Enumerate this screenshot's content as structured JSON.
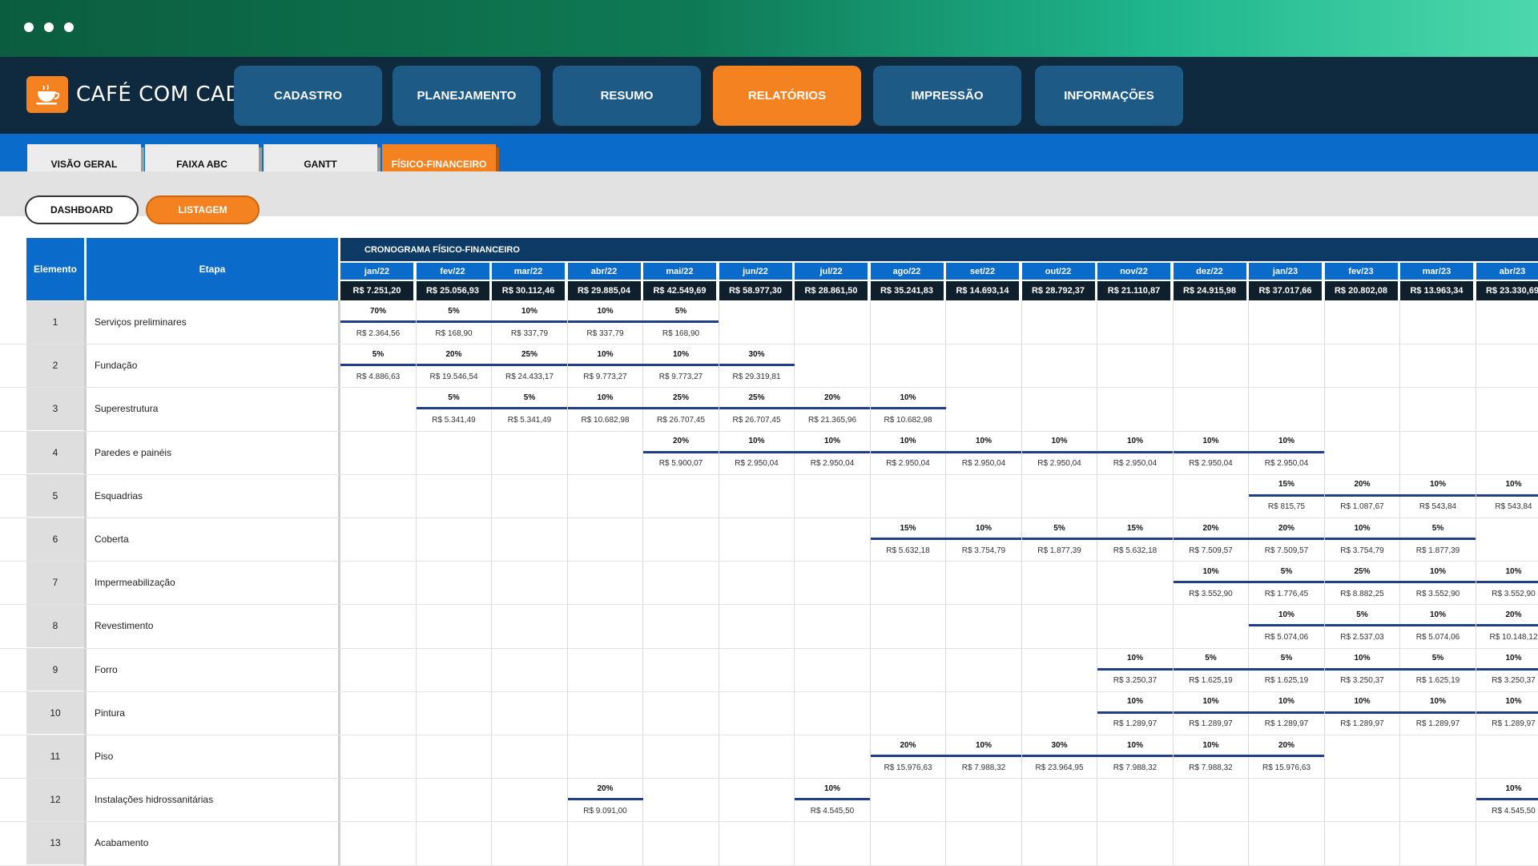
{
  "app": {
    "logo_text": "CAFÉ COM CAD"
  },
  "nav": [
    {
      "label": "CADASTRO",
      "active": false
    },
    {
      "label": "PLANEJAMENTO",
      "active": false
    },
    {
      "label": "RESUMO",
      "active": false
    },
    {
      "label": "RELATÓRIOS",
      "active": true
    },
    {
      "label": "IMPRESSÃO",
      "active": false
    },
    {
      "label": "INFORMAÇÕES",
      "active": false
    }
  ],
  "subtabs": [
    {
      "label": "VISÃO GERAL",
      "active": false
    },
    {
      "label": "FAIXA ABC",
      "active": false
    },
    {
      "label": "GANTT",
      "active": false
    },
    {
      "label": "FÍSICO-FINANCEIRO",
      "active": true
    }
  ],
  "views": [
    {
      "label": "DASHBOARD",
      "active": false
    },
    {
      "label": "LISTAGEM",
      "active": true
    }
  ],
  "colors": {
    "accent": "#f58220",
    "navy": "#0f2a3e",
    "blue": "#0b6bcb",
    "bar": "#1f3f8a"
  },
  "table": {
    "col_elemento": "Elemento",
    "col_etapa": "Etapa",
    "schedule_title": "CRONOGRAMA FÍSICO-FINANCEIRO",
    "months": [
      {
        "label": "jan/22",
        "total": "R$ 7.251,20"
      },
      {
        "label": "fev/22",
        "total": "R$ 25.056,93"
      },
      {
        "label": "mar/22",
        "total": "R$ 30.112,46"
      },
      {
        "label": "abr/22",
        "total": "R$ 29.885,04"
      },
      {
        "label": "mai/22",
        "total": "R$ 42.549,69"
      },
      {
        "label": "jun/22",
        "total": "R$ 58.977,30"
      },
      {
        "label": "jul/22",
        "total": "R$ 28.861,50"
      },
      {
        "label": "ago/22",
        "total": "R$ 35.241,83"
      },
      {
        "label": "set/22",
        "total": "R$ 14.693,14"
      },
      {
        "label": "out/22",
        "total": "R$ 28.792,37"
      },
      {
        "label": "nov/22",
        "total": "R$ 21.110,87"
      },
      {
        "label": "dez/22",
        "total": "R$ 24.915,98"
      },
      {
        "label": "jan/23",
        "total": "R$ 37.017,66"
      },
      {
        "label": "fev/23",
        "total": "R$ 20.802,08"
      },
      {
        "label": "mar/23",
        "total": "R$ 13.963,34"
      },
      {
        "label": "abr/23",
        "total": "R$ 23.330,69"
      }
    ],
    "rows": [
      {
        "id": "1",
        "name": "Serviços preliminares",
        "cells": [
          [
            0,
            "70%",
            "R$ 2.364,56"
          ],
          [
            1,
            "5%",
            "R$ 168,90"
          ],
          [
            2,
            "10%",
            "R$ 337,79"
          ],
          [
            3,
            "10%",
            "R$ 337,79"
          ],
          [
            4,
            "5%",
            "R$ 168,90"
          ]
        ]
      },
      {
        "id": "2",
        "name": "Fundação",
        "cells": [
          [
            0,
            "5%",
            "R$ 4.886,63"
          ],
          [
            1,
            "20%",
            "R$ 19.546,54"
          ],
          [
            2,
            "25%",
            "R$ 24.433,17"
          ],
          [
            3,
            "10%",
            "R$ 9.773,27"
          ],
          [
            4,
            "10%",
            "R$ 9.773,27"
          ],
          [
            5,
            "30%",
            "R$ 29.319,81"
          ]
        ]
      },
      {
        "id": "3",
        "name": "Superestrutura",
        "cells": [
          [
            1,
            "5%",
            "R$ 5.341,49"
          ],
          [
            2,
            "5%",
            "R$ 5.341,49"
          ],
          [
            3,
            "10%",
            "R$ 10.682,98"
          ],
          [
            4,
            "25%",
            "R$ 26.707,45"
          ],
          [
            5,
            "25%",
            "R$ 26.707,45"
          ],
          [
            6,
            "20%",
            "R$ 21.365,96"
          ],
          [
            7,
            "10%",
            "R$ 10.682,98"
          ]
        ]
      },
      {
        "id": "4",
        "name": "Paredes e painéis",
        "cells": [
          [
            4,
            "20%",
            "R$ 5.900,07"
          ],
          [
            5,
            "10%",
            "R$ 2.950,04"
          ],
          [
            6,
            "10%",
            "R$ 2.950,04"
          ],
          [
            7,
            "10%",
            "R$ 2.950,04"
          ],
          [
            8,
            "10%",
            "R$ 2.950,04"
          ],
          [
            9,
            "10%",
            "R$ 2.950,04"
          ],
          [
            10,
            "10%",
            "R$ 2.950,04"
          ],
          [
            11,
            "10%",
            "R$ 2.950,04"
          ],
          [
            12,
            "10%",
            "R$ 2.950,04"
          ]
        ]
      },
      {
        "id": "5",
        "name": "Esquadrias",
        "cells": [
          [
            12,
            "15%",
            "R$ 815,75"
          ],
          [
            13,
            "20%",
            "R$ 1.087,67"
          ],
          [
            14,
            "10%",
            "R$ 543,84"
          ],
          [
            15,
            "10%",
            "R$ 543,84"
          ]
        ]
      },
      {
        "id": "6",
        "name": "Coberta",
        "cells": [
          [
            7,
            "15%",
            "R$ 5.632,18"
          ],
          [
            8,
            "10%",
            "R$ 3.754,79"
          ],
          [
            9,
            "5%",
            "R$ 1.877,39"
          ],
          [
            10,
            "15%",
            "R$ 5.632,18"
          ],
          [
            11,
            "20%",
            "R$ 7.509,57"
          ],
          [
            12,
            "20%",
            "R$ 7.509,57"
          ],
          [
            13,
            "10%",
            "R$ 3.754,79"
          ],
          [
            14,
            "5%",
            "R$ 1.877,39"
          ]
        ]
      },
      {
        "id": "7",
        "name": "Impermeabilização",
        "cells": [
          [
            11,
            "10%",
            "R$ 3.552,90"
          ],
          [
            12,
            "5%",
            "R$ 1.776,45"
          ],
          [
            13,
            "25%",
            "R$ 8.882,25"
          ],
          [
            14,
            "10%",
            "R$ 3.552,90"
          ],
          [
            15,
            "10%",
            "R$ 3.552,90"
          ]
        ]
      },
      {
        "id": "8",
        "name": "Revestimento",
        "cells": [
          [
            12,
            "10%",
            "R$ 5.074,06"
          ],
          [
            13,
            "5%",
            "R$ 2.537,03"
          ],
          [
            14,
            "10%",
            "R$ 5.074,06"
          ],
          [
            15,
            "20%",
            "R$ 10.148,12"
          ]
        ]
      },
      {
        "id": "9",
        "name": "Forro",
        "cells": [
          [
            10,
            "10%",
            "R$ 3.250,37"
          ],
          [
            11,
            "5%",
            "R$ 1.625,19"
          ],
          [
            12,
            "5%",
            "R$ 1.625,19"
          ],
          [
            13,
            "10%",
            "R$ 3.250,37"
          ],
          [
            14,
            "5%",
            "R$ 1.625,19"
          ],
          [
            15,
            "10%",
            "R$ 3.250,37"
          ]
        ]
      },
      {
        "id": "10",
        "name": "Pintura",
        "cells": [
          [
            10,
            "10%",
            "R$ 1.289,97"
          ],
          [
            11,
            "10%",
            "R$ 1.289,97"
          ],
          [
            12,
            "10%",
            "R$ 1.289,97"
          ],
          [
            13,
            "10%",
            "R$ 1.289,97"
          ],
          [
            14,
            "10%",
            "R$ 1.289,97"
          ],
          [
            15,
            "10%",
            "R$ 1.289,97"
          ]
        ]
      },
      {
        "id": "11",
        "name": "Piso",
        "cells": [
          [
            7,
            "20%",
            "R$ 15.976,63"
          ],
          [
            8,
            "10%",
            "R$ 7.988,32"
          ],
          [
            9,
            "30%",
            "R$ 23.964,95"
          ],
          [
            10,
            "10%",
            "R$ 7.988,32"
          ],
          [
            11,
            "10%",
            "R$ 7.988,32"
          ],
          [
            12,
            "20%",
            "R$ 15.976,63"
          ]
        ]
      },
      {
        "id": "12",
        "name": "Instalações hidrossanitárias",
        "cells": [
          [
            3,
            "20%",
            "R$ 9.091,00"
          ],
          [
            6,
            "10%",
            "R$ 4.545,50"
          ],
          [
            15,
            "10%",
            "R$ 4.545,50"
          ]
        ]
      },
      {
        "id": "13",
        "name": "Acabamento",
        "cells": []
      }
    ]
  }
}
